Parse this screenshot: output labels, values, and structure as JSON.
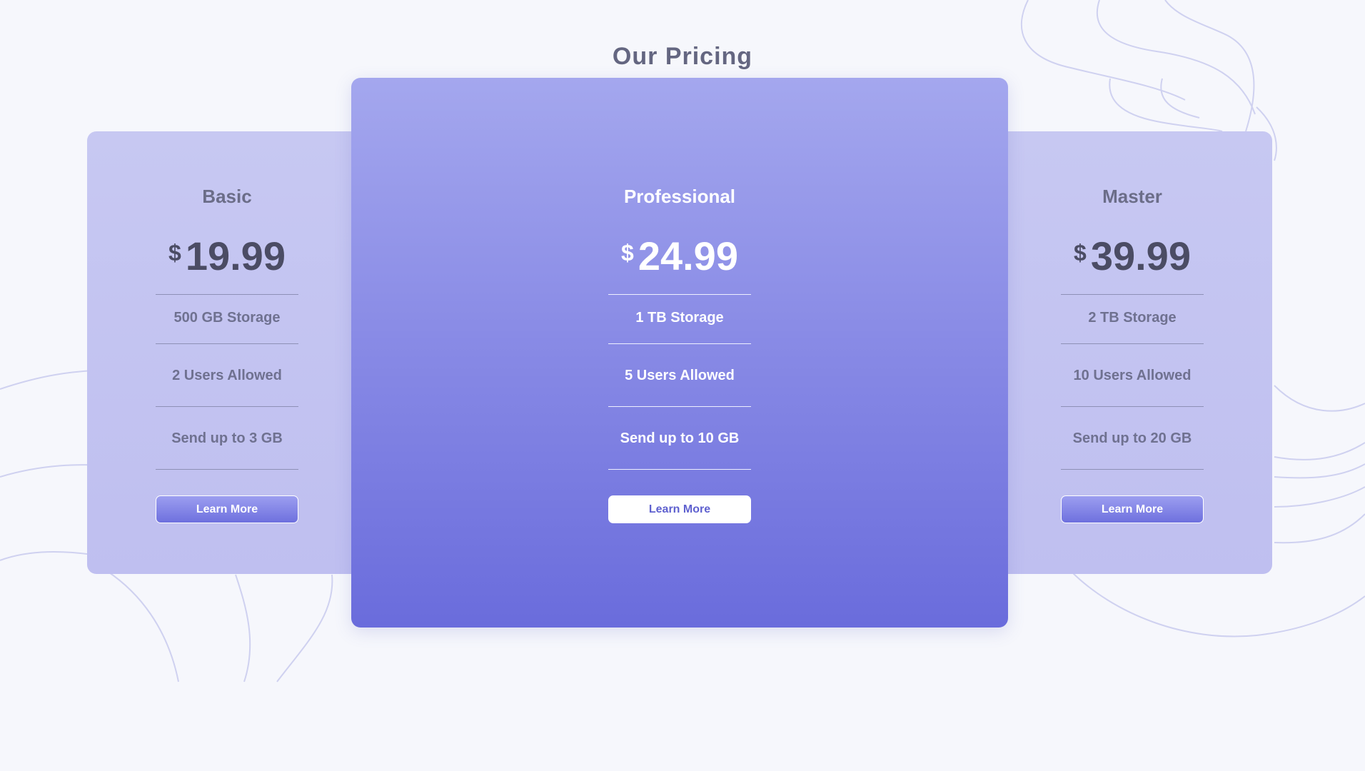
{
  "page": {
    "title": "Our Pricing"
  },
  "plans": [
    {
      "name": "Basic",
      "currency": "$",
      "price": "19.99",
      "features": [
        "500 GB Storage",
        "2 Users Allowed",
        "Send up to 3 GB"
      ],
      "button_label": "Learn More"
    },
    {
      "name": "Professional",
      "currency": "$",
      "price": "24.99",
      "features": [
        "1 TB Storage",
        "5 Users Allowed",
        "Send up to 10 GB"
      ],
      "button_label": "Learn More"
    },
    {
      "name": "Master",
      "currency": "$",
      "price": "39.99",
      "features": [
        "2 TB Storage",
        "10 Users Allowed",
        "Send up to 20 GB"
      ],
      "button_label": "Learn More"
    }
  ],
  "colors": {
    "background": "#f6f7fc",
    "side_card": "#c3c4f1",
    "featured_card_top": "#a4a7ee",
    "featured_card_bottom": "#6a6cdc",
    "title_text": "#646681",
    "price_text": "#4b4c64",
    "decor_lines": "#cfd1f0"
  }
}
